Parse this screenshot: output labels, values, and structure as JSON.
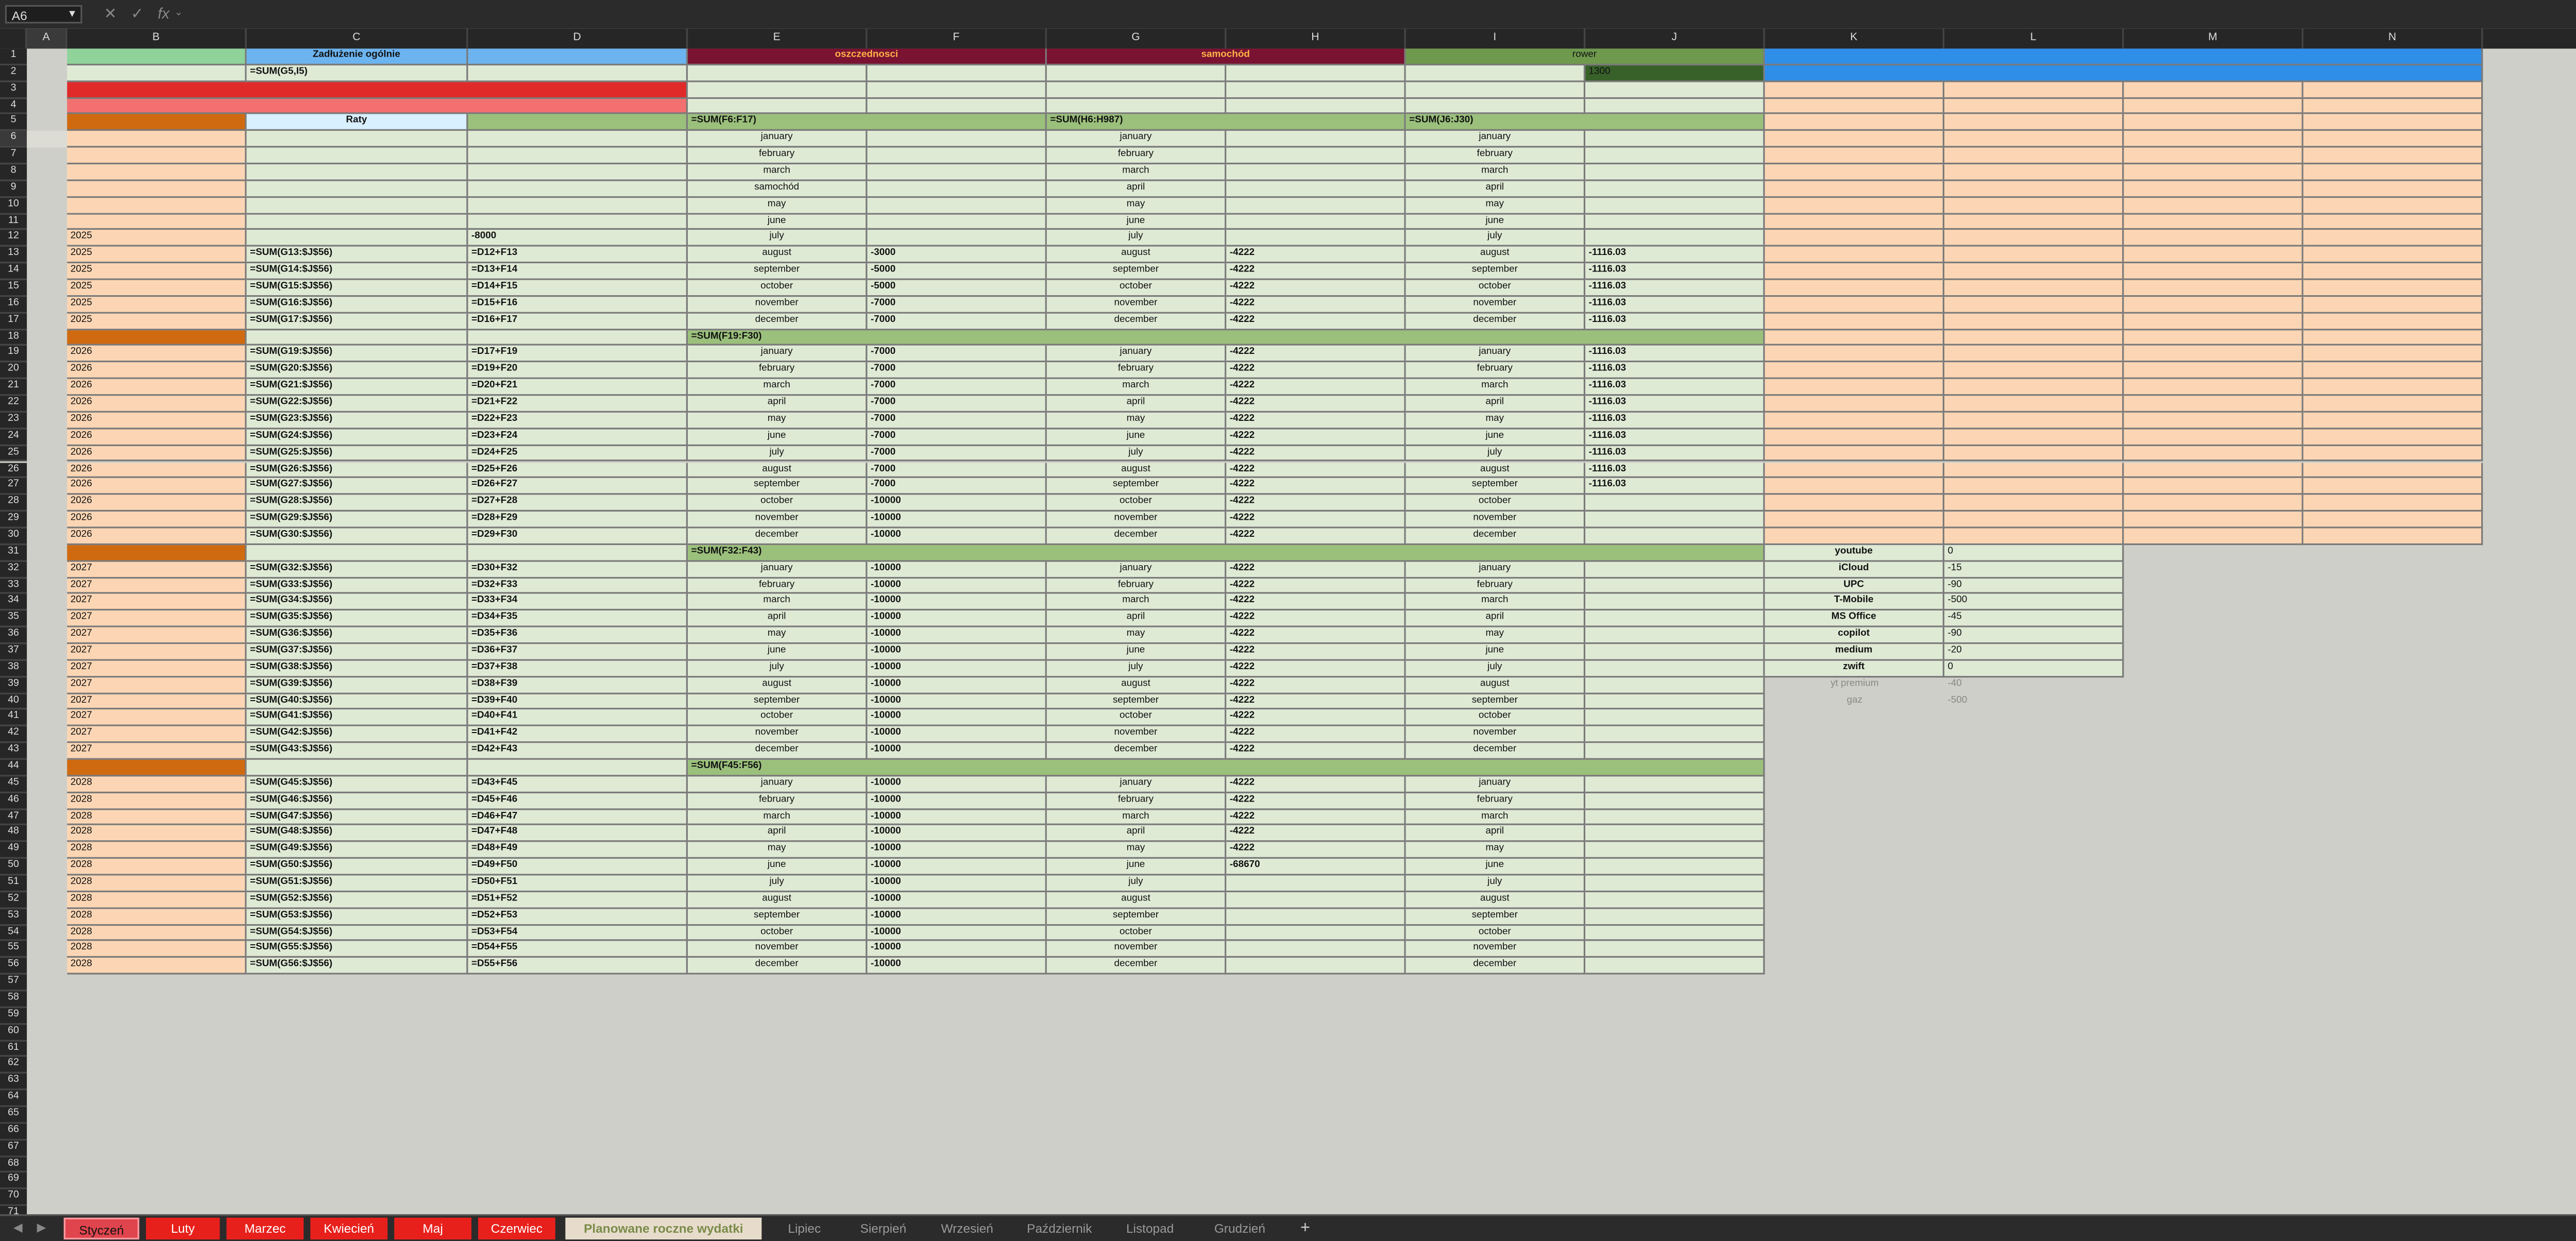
{
  "formula_bar": {
    "cell_ref": "A6",
    "fx_label": "fx",
    "formula": ""
  },
  "colors": {
    "peach": "#fcd6b4",
    "green_light": "#dfead5",
    "green_header": "#9bc07c",
    "orange": "#d06a10",
    "blue": "#6cb4f0",
    "blue_bright": "#2f8ee8",
    "maroon": "#7a1232",
    "red": "#e02a2a",
    "dark_green": "#38612a"
  },
  "columns": [
    "A",
    "B",
    "C",
    "D",
    "E",
    "F",
    "G",
    "H",
    "I",
    "J",
    "K",
    "L",
    "M",
    "N"
  ],
  "rows_count": 74,
  "header": {
    "b1": "",
    "c1": "Zadłużenie ogólnie",
    "e1": "oszczednosci",
    "g1": "samochód",
    "i1": "rower",
    "c2": "=SUM(G5,I5)",
    "j2": "1300",
    "c5": "Raty",
    "e5": "=SUM(F6:F17)",
    "g5": "=SUM(H6:H987)",
    "i5": "=SUM(J6:J30)"
  },
  "section_formulas": {
    "r18": "=SUM(F19:F30)",
    "r31": "=SUM(F32:F43)",
    "r44": "=SUM(F45:F56)"
  },
  "months": [
    "january",
    "february",
    "march",
    "april",
    "may",
    "june",
    "july",
    "august",
    "september",
    "october",
    "november",
    "december"
  ],
  "e_months_2024": [
    "january",
    "february",
    "march",
    "samochód",
    "may",
    "june",
    "july"
  ],
  "g_months_2024": [
    "january",
    "february",
    "march",
    "april",
    "may",
    "june",
    "july"
  ],
  "d12": "-8000",
  "years": {
    "y2025": "2025",
    "y2026": "2026",
    "y2027": "2027",
    "y2028": "2028"
  },
  "f_values": {
    "r13": "-3000",
    "r14": "-5000",
    "r15": "-5000",
    "r16": "-7000",
    "r17": "-7000",
    "r19": "-7000",
    "r20": "-7000",
    "r21": "-7000",
    "r22": "-7000",
    "r23": "-7000",
    "r24": "-7000",
    "r25": "-7000",
    "r26": "-7000",
    "r27": "-7000",
    "r28": "-10000",
    "r29": "-10000",
    "r30": "-10000",
    "r32": "-10000",
    "r33": "-10000",
    "r34": "-10000",
    "r35": "-10000",
    "r36": "-10000",
    "r37": "-10000",
    "r38": "-10000",
    "r39": "-10000",
    "r40": "-10000",
    "r41": "-10000",
    "r42": "-10000",
    "r43": "-10000",
    "r45": "-10000",
    "r46": "-10000",
    "r47": "-10000",
    "r48": "-10000",
    "r49": "-10000",
    "r50": "-10000",
    "r51": "-10000",
    "r52": "-10000",
    "r53": "-10000",
    "r54": "-10000",
    "r55": "-10000",
    "r56": "-10000"
  },
  "h_value": "-4222",
  "h50": "-68670",
  "j_value": "-1116.03",
  "subscriptions": [
    {
      "name": "youtube",
      "value": "0"
    },
    {
      "name": "iCloud",
      "value": "-15"
    },
    {
      "name": "UPC",
      "value": "-90"
    },
    {
      "name": "T-Mobile",
      "value": "-500"
    },
    {
      "name": "MS Office",
      "value": "-45"
    },
    {
      "name": "copilot",
      "value": "-90"
    },
    {
      "name": "medium",
      "value": "-20"
    },
    {
      "name": "zwift",
      "value": "0"
    }
  ],
  "extra_subscriptions": [
    {
      "name": "yt premium",
      "value": "-40"
    },
    {
      "name": "gaz",
      "value": "-500"
    }
  ],
  "tabs": [
    {
      "label": "Styczeń",
      "style": "active-red"
    },
    {
      "label": "Luty",
      "style": "red"
    },
    {
      "label": "Marzec",
      "style": "red"
    },
    {
      "label": "Kwiecień",
      "style": "red"
    },
    {
      "label": "Maj",
      "style": "red"
    },
    {
      "label": "Czerwiec",
      "style": "red"
    },
    {
      "label": "Planowane roczne wydatki",
      "style": "selected"
    },
    {
      "label": "Lipiec",
      "style": "plain"
    },
    {
      "label": "Sierpień",
      "style": "plain"
    },
    {
      "label": "Wrzesień",
      "style": "plain"
    },
    {
      "label": "Październik",
      "style": "plain"
    },
    {
      "label": "Listopad",
      "style": "plain"
    },
    {
      "label": "Grudzień",
      "style": "plain"
    }
  ],
  "add_tab_label": "+"
}
